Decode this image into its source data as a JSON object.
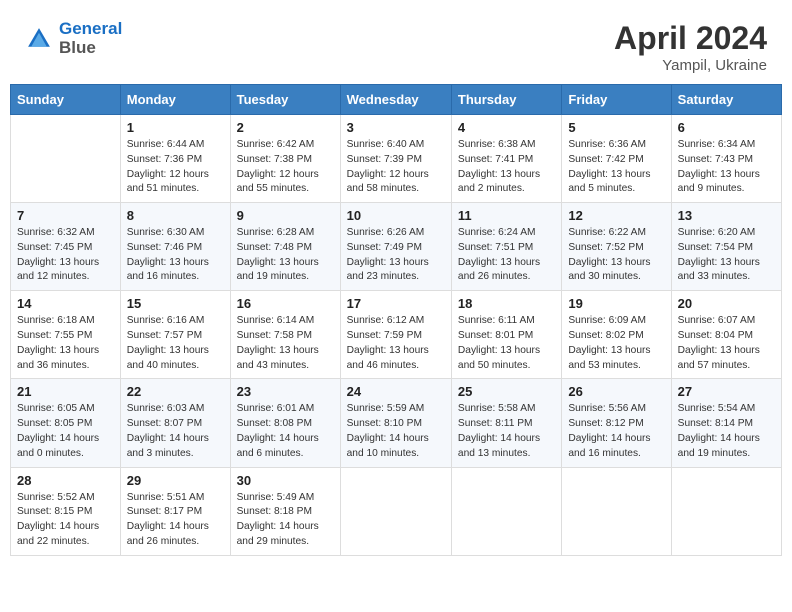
{
  "logo": {
    "line1": "General",
    "line2": "Blue"
  },
  "header": {
    "month": "April 2024",
    "location": "Yampil, Ukraine"
  },
  "columns": [
    "Sunday",
    "Monday",
    "Tuesday",
    "Wednesday",
    "Thursday",
    "Friday",
    "Saturday"
  ],
  "weeks": [
    [
      {
        "day": "",
        "sunrise": "",
        "sunset": "",
        "daylight": ""
      },
      {
        "day": "1",
        "sunrise": "Sunrise: 6:44 AM",
        "sunset": "Sunset: 7:36 PM",
        "daylight": "Daylight: 12 hours and 51 minutes."
      },
      {
        "day": "2",
        "sunrise": "Sunrise: 6:42 AM",
        "sunset": "Sunset: 7:38 PM",
        "daylight": "Daylight: 12 hours and 55 minutes."
      },
      {
        "day": "3",
        "sunrise": "Sunrise: 6:40 AM",
        "sunset": "Sunset: 7:39 PM",
        "daylight": "Daylight: 12 hours and 58 minutes."
      },
      {
        "day": "4",
        "sunrise": "Sunrise: 6:38 AM",
        "sunset": "Sunset: 7:41 PM",
        "daylight": "Daylight: 13 hours and 2 minutes."
      },
      {
        "day": "5",
        "sunrise": "Sunrise: 6:36 AM",
        "sunset": "Sunset: 7:42 PM",
        "daylight": "Daylight: 13 hours and 5 minutes."
      },
      {
        "day": "6",
        "sunrise": "Sunrise: 6:34 AM",
        "sunset": "Sunset: 7:43 PM",
        "daylight": "Daylight: 13 hours and 9 minutes."
      }
    ],
    [
      {
        "day": "7",
        "sunrise": "Sunrise: 6:32 AM",
        "sunset": "Sunset: 7:45 PM",
        "daylight": "Daylight: 13 hours and 12 minutes."
      },
      {
        "day": "8",
        "sunrise": "Sunrise: 6:30 AM",
        "sunset": "Sunset: 7:46 PM",
        "daylight": "Daylight: 13 hours and 16 minutes."
      },
      {
        "day": "9",
        "sunrise": "Sunrise: 6:28 AM",
        "sunset": "Sunset: 7:48 PM",
        "daylight": "Daylight: 13 hours and 19 minutes."
      },
      {
        "day": "10",
        "sunrise": "Sunrise: 6:26 AM",
        "sunset": "Sunset: 7:49 PM",
        "daylight": "Daylight: 13 hours and 23 minutes."
      },
      {
        "day": "11",
        "sunrise": "Sunrise: 6:24 AM",
        "sunset": "Sunset: 7:51 PM",
        "daylight": "Daylight: 13 hours and 26 minutes."
      },
      {
        "day": "12",
        "sunrise": "Sunrise: 6:22 AM",
        "sunset": "Sunset: 7:52 PM",
        "daylight": "Daylight: 13 hours and 30 minutes."
      },
      {
        "day": "13",
        "sunrise": "Sunrise: 6:20 AM",
        "sunset": "Sunset: 7:54 PM",
        "daylight": "Daylight: 13 hours and 33 minutes."
      }
    ],
    [
      {
        "day": "14",
        "sunrise": "Sunrise: 6:18 AM",
        "sunset": "Sunset: 7:55 PM",
        "daylight": "Daylight: 13 hours and 36 minutes."
      },
      {
        "day": "15",
        "sunrise": "Sunrise: 6:16 AM",
        "sunset": "Sunset: 7:57 PM",
        "daylight": "Daylight: 13 hours and 40 minutes."
      },
      {
        "day": "16",
        "sunrise": "Sunrise: 6:14 AM",
        "sunset": "Sunset: 7:58 PM",
        "daylight": "Daylight: 13 hours and 43 minutes."
      },
      {
        "day": "17",
        "sunrise": "Sunrise: 6:12 AM",
        "sunset": "Sunset: 7:59 PM",
        "daylight": "Daylight: 13 hours and 46 minutes."
      },
      {
        "day": "18",
        "sunrise": "Sunrise: 6:11 AM",
        "sunset": "Sunset: 8:01 PM",
        "daylight": "Daylight: 13 hours and 50 minutes."
      },
      {
        "day": "19",
        "sunrise": "Sunrise: 6:09 AM",
        "sunset": "Sunset: 8:02 PM",
        "daylight": "Daylight: 13 hours and 53 minutes."
      },
      {
        "day": "20",
        "sunrise": "Sunrise: 6:07 AM",
        "sunset": "Sunset: 8:04 PM",
        "daylight": "Daylight: 13 hours and 57 minutes."
      }
    ],
    [
      {
        "day": "21",
        "sunrise": "Sunrise: 6:05 AM",
        "sunset": "Sunset: 8:05 PM",
        "daylight": "Daylight: 14 hours and 0 minutes."
      },
      {
        "day": "22",
        "sunrise": "Sunrise: 6:03 AM",
        "sunset": "Sunset: 8:07 PM",
        "daylight": "Daylight: 14 hours and 3 minutes."
      },
      {
        "day": "23",
        "sunrise": "Sunrise: 6:01 AM",
        "sunset": "Sunset: 8:08 PM",
        "daylight": "Daylight: 14 hours and 6 minutes."
      },
      {
        "day": "24",
        "sunrise": "Sunrise: 5:59 AM",
        "sunset": "Sunset: 8:10 PM",
        "daylight": "Daylight: 14 hours and 10 minutes."
      },
      {
        "day": "25",
        "sunrise": "Sunrise: 5:58 AM",
        "sunset": "Sunset: 8:11 PM",
        "daylight": "Daylight: 14 hours and 13 minutes."
      },
      {
        "day": "26",
        "sunrise": "Sunrise: 5:56 AM",
        "sunset": "Sunset: 8:12 PM",
        "daylight": "Daylight: 14 hours and 16 minutes."
      },
      {
        "day": "27",
        "sunrise": "Sunrise: 5:54 AM",
        "sunset": "Sunset: 8:14 PM",
        "daylight": "Daylight: 14 hours and 19 minutes."
      }
    ],
    [
      {
        "day": "28",
        "sunrise": "Sunrise: 5:52 AM",
        "sunset": "Sunset: 8:15 PM",
        "daylight": "Daylight: 14 hours and 22 minutes."
      },
      {
        "day": "29",
        "sunrise": "Sunrise: 5:51 AM",
        "sunset": "Sunset: 8:17 PM",
        "daylight": "Daylight: 14 hours and 26 minutes."
      },
      {
        "day": "30",
        "sunrise": "Sunrise: 5:49 AM",
        "sunset": "Sunset: 8:18 PM",
        "daylight": "Daylight: 14 hours and 29 minutes."
      },
      {
        "day": "",
        "sunrise": "",
        "sunset": "",
        "daylight": ""
      },
      {
        "day": "",
        "sunrise": "",
        "sunset": "",
        "daylight": ""
      },
      {
        "day": "",
        "sunrise": "",
        "sunset": "",
        "daylight": ""
      },
      {
        "day": "",
        "sunrise": "",
        "sunset": "",
        "daylight": ""
      }
    ]
  ]
}
